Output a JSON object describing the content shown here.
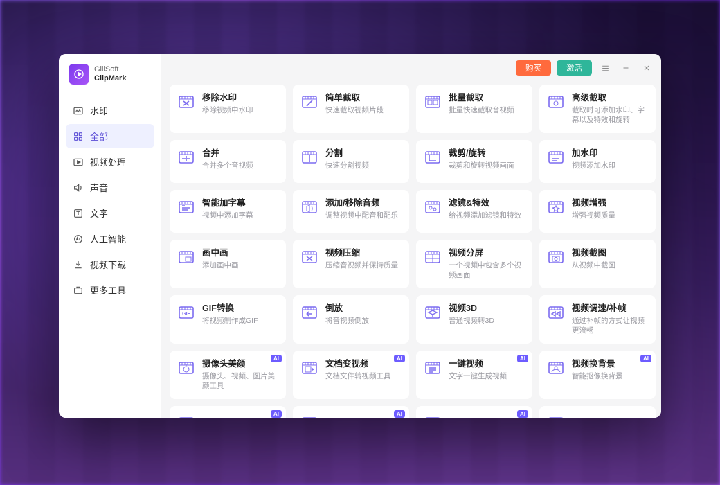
{
  "brand": {
    "line1": "GiliSoft",
    "line2": "ClipMark"
  },
  "titlebar": {
    "buy": "购买",
    "activate": "激活"
  },
  "sidebar": {
    "items": [
      {
        "icon": "watermark",
        "label": "水印"
      },
      {
        "icon": "grid",
        "label": "全部"
      },
      {
        "icon": "video",
        "label": "视频处理"
      },
      {
        "icon": "sound",
        "label": "声音"
      },
      {
        "icon": "text",
        "label": "文字"
      },
      {
        "icon": "ai",
        "label": "人工智能"
      },
      {
        "icon": "download",
        "label": "视频下载"
      },
      {
        "icon": "tools",
        "label": "更多工具"
      }
    ],
    "activeIndex": 1
  },
  "ai_badge": "AI",
  "cards": [
    {
      "icon": "film-x",
      "title": "移除水印",
      "desc": "移除视频中水印"
    },
    {
      "icon": "film-cut",
      "title": "简单截取",
      "desc": "快速截取视频片段"
    },
    {
      "icon": "film-batch",
      "title": "批量截取",
      "desc": "批量快速截取音视频"
    },
    {
      "icon": "film-adv",
      "title": "高级截取",
      "desc": "截取时可添加水印、字幕以及特效和旋转"
    },
    {
      "icon": "merge",
      "title": "合并",
      "desc": "合并多个音视频"
    },
    {
      "icon": "split",
      "title": "分割",
      "desc": "快速分割视频"
    },
    {
      "icon": "crop",
      "title": "裁剪/旋转",
      "desc": "裁剪和旋转视频画面"
    },
    {
      "icon": "addwm",
      "title": "加水印",
      "desc": "视频添加水印"
    },
    {
      "icon": "subtitle",
      "title": "智能加字幕",
      "desc": "视频中添加字幕"
    },
    {
      "icon": "audio",
      "title": "添加/移除音频",
      "desc": "调整视频中配音和配乐"
    },
    {
      "icon": "fx",
      "title": "滤镜&特效",
      "desc": "给视频添加滤镜和特效"
    },
    {
      "icon": "enhance",
      "title": "视频增强",
      "desc": "增强视频质量"
    },
    {
      "icon": "pip",
      "title": "画中画",
      "desc": "添加画中画"
    },
    {
      "icon": "compress",
      "title": "视频压缩",
      "desc": "压缩音视频并保持质量"
    },
    {
      "icon": "splitscr",
      "title": "视频分屏",
      "desc": "一个视频中包含多个视频画面"
    },
    {
      "icon": "snapshot",
      "title": "视频截图",
      "desc": "从视频中截图"
    },
    {
      "icon": "gif",
      "title": "GIF转换",
      "desc": "将视频制作成GIF"
    },
    {
      "icon": "reverse",
      "title": "倒放",
      "desc": "将音视频倒放"
    },
    {
      "icon": "v3d",
      "title": "视频3D",
      "desc": "普通视频转3D"
    },
    {
      "icon": "speed",
      "title": "视频调速/补帧",
      "desc": "通过补帧的方式让视频更流畅"
    },
    {
      "icon": "beauty",
      "title": "摄像头美颜",
      "desc": "摄像头、视频、图片美颜工具",
      "ai": true
    },
    {
      "icon": "doc2vid",
      "title": "文档变视频",
      "desc": "文档文件转视频工具",
      "ai": true
    },
    {
      "icon": "onekey",
      "title": "一键视频",
      "desc": "文字一键生成视频",
      "ai": true
    },
    {
      "icon": "bg",
      "title": "视频换背景",
      "desc": "智能抠像换背景",
      "ai": true
    },
    {
      "icon": "more",
      "title": "",
      "desc": "",
      "ai": true
    },
    {
      "icon": "more",
      "title": "",
      "desc": "",
      "ai": true
    },
    {
      "icon": "more",
      "title": "",
      "desc": "",
      "ai": true
    },
    {
      "icon": "more",
      "title": "",
      "desc": ""
    }
  ]
}
